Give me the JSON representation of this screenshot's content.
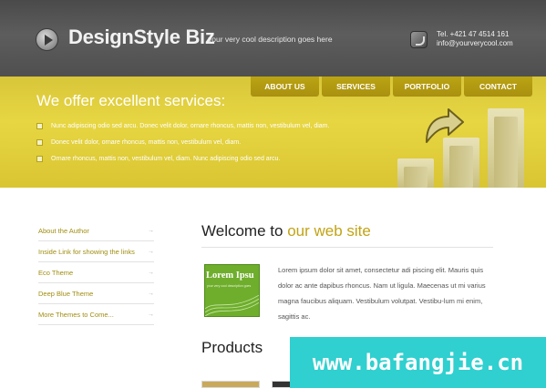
{
  "header": {
    "logo": "DesignStyle Biz",
    "tagline": "your very cool description goes here",
    "phone": "Tel. +421 47 4514 161",
    "email": "info@yourverycool.com"
  },
  "nav": {
    "items": [
      "ABOUT US",
      "SERVICES",
      "PORTFOLIO",
      "CONTACT"
    ]
  },
  "banner": {
    "title": "We offer excellent services:",
    "bullets": [
      "Nunc adipiscing odio sed arcu. Donec velit dolor, ornare rhoncus, mattis non, vestibulum vel, diam.",
      "Donec velit dolor, ornare rhoncus, mattis non, vestibulum vel, diam.",
      "Ornare rhoncus, mattis non, vestibulum vel, diam. Nunc adipiscing odio sed arcu."
    ]
  },
  "sidebar": {
    "items": [
      "About the Author",
      "Inside Link for showing the links",
      "Eco Theme",
      "Deep Blue Theme",
      "More Themes to Come..."
    ],
    "arrow": "→"
  },
  "main": {
    "welcome_prefix": "Welcome to",
    "welcome_highlight": "our web site",
    "thumb_title": "Lorem Ipsu",
    "thumb_sub": "your very cool description goes",
    "body": "Lorem ipsum dolor sit amet, consectetur adi piscing elit. Mauris quis dolor ac ante dapibus rhoncus. Nam ut ligula. Maecenas ut mi varius magna faucibus aliquam. Vestibulum volutpat. Vestibu-lum mi enim, sagittis ac.",
    "products_title": "Products"
  },
  "watermark": "www.bafangjie.cn",
  "colors": {
    "header_bg": "#555555",
    "band_bg": "#e1d03c",
    "nav_bg": "#b49d12",
    "accent": "#c2a314",
    "link": "#a08d10"
  },
  "icons": {
    "logo": "play-icon",
    "contact": "phone-icon",
    "bullet": "checkbox-icon",
    "graphic": "growth-chart-arrow"
  }
}
